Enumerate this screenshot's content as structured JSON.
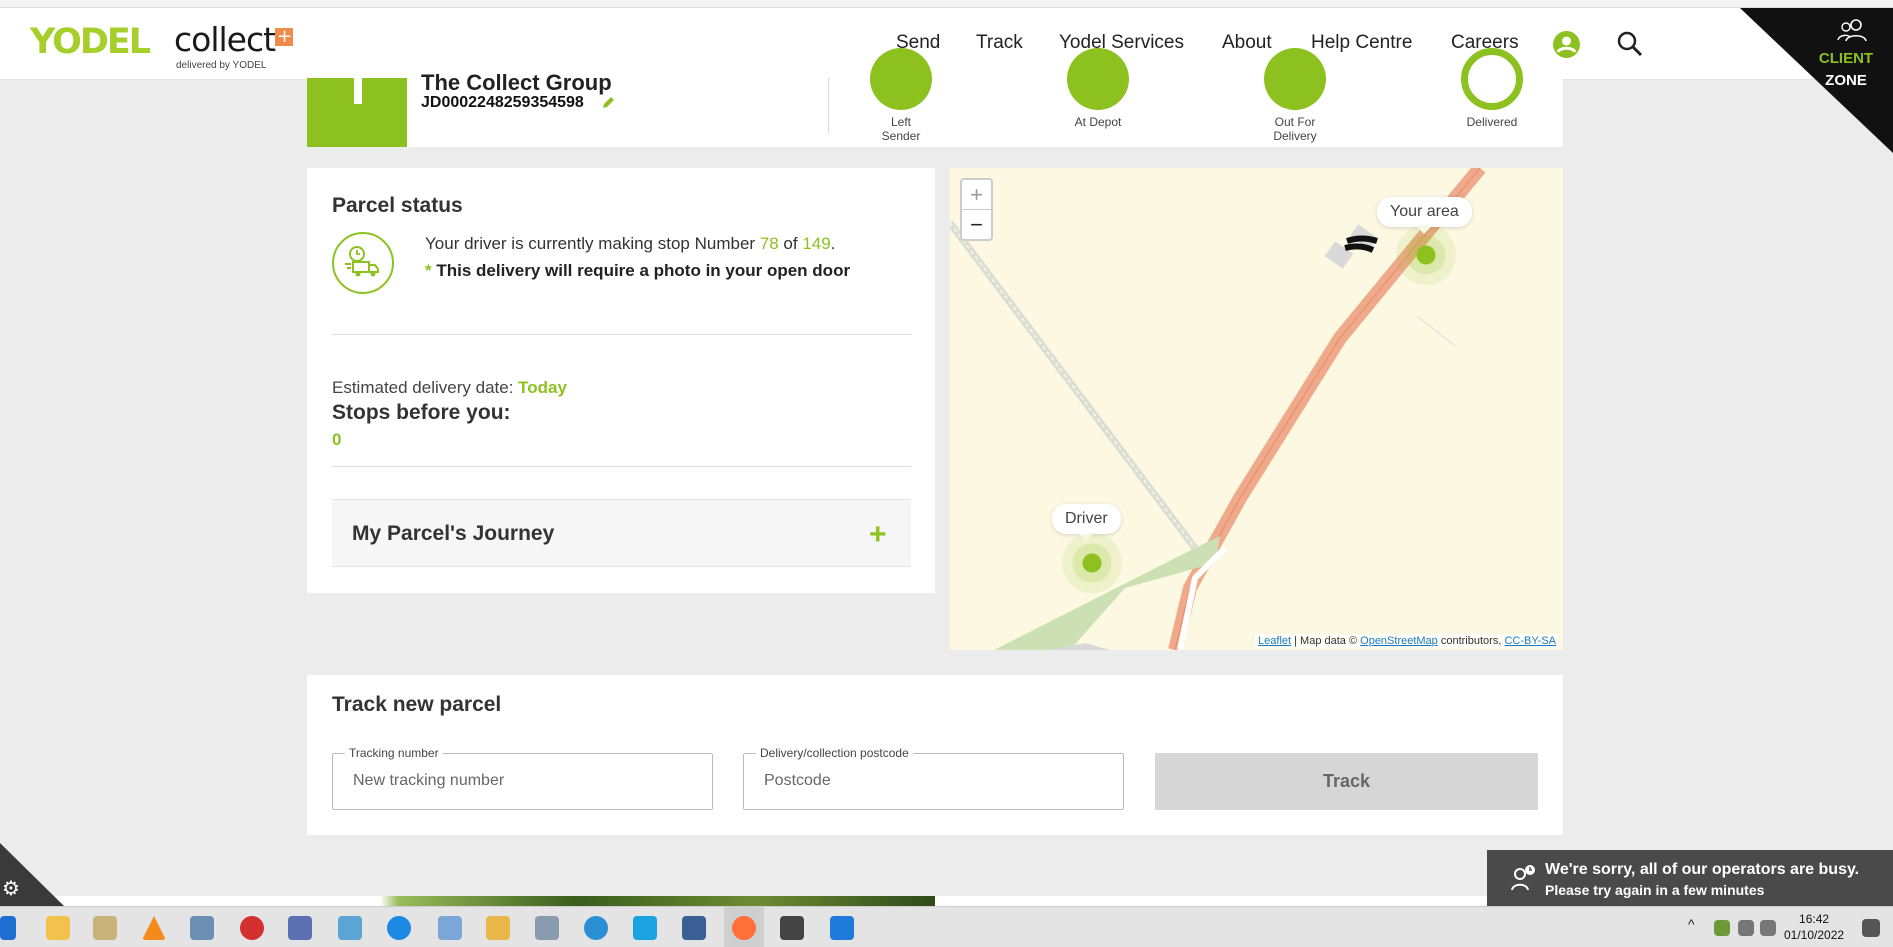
{
  "header": {
    "logo_primary": "YODEL",
    "logo_secondary": "collect",
    "logo_plus": "+",
    "logo_tagline": "delivered by YODEL",
    "nav": [
      "Send",
      "Track",
      "Yodel Services",
      "About",
      "Help Centre",
      "Careers"
    ],
    "client_zone_top": "CLIENT",
    "client_zone_bottom": "ZONE"
  },
  "summary": {
    "sender_name": "The Collect Group",
    "tracking_id": "JD0002248259354598",
    "steps": [
      "Left Sender",
      "At Depot",
      "Out For Delivery",
      "Delivered"
    ]
  },
  "status": {
    "title": "Parcel status",
    "driver_prefix": "Your driver is currently making stop Number ",
    "current_stop": "78",
    "of_word": " of ",
    "total_stops": "149",
    "period": ".",
    "asterisk": "* ",
    "photo_note": "This delivery will require a photo in your open door",
    "estimated_label": "Estimated delivery date: ",
    "estimated_value": "Today",
    "stops_before_label": "Stops before you:",
    "stops_before_value": "0",
    "journey_label": "My Parcel's Journey",
    "journey_toggle": "+"
  },
  "map": {
    "zoom_in": "+",
    "zoom_out": "−",
    "your_area_label": "Your area",
    "driver_label": "Driver",
    "attribution_leaflet": "Leaflet",
    "attribution_mid": " | Map data © ",
    "attribution_osm": "OpenStreetMap",
    "attribution_contrib": " contributors, ",
    "attribution_license": "CC-BY-SA"
  },
  "track_new": {
    "title": "Track new parcel",
    "tracking_legend": "Tracking number",
    "tracking_placeholder": "New tracking number",
    "postcode_legend": "Delivery/collection postcode",
    "postcode_placeholder": "Postcode",
    "button_label": "Track"
  },
  "chat": {
    "line1": "We're sorry, all of our operators are busy.",
    "line2": "Please try again in a few minutes"
  },
  "taskbar": {
    "time": "16:42",
    "date": "01/10/2022"
  },
  "colors": {
    "brand_green": "#8cc11f",
    "header_black": "#111111",
    "road_orange": "#f0a98a"
  }
}
